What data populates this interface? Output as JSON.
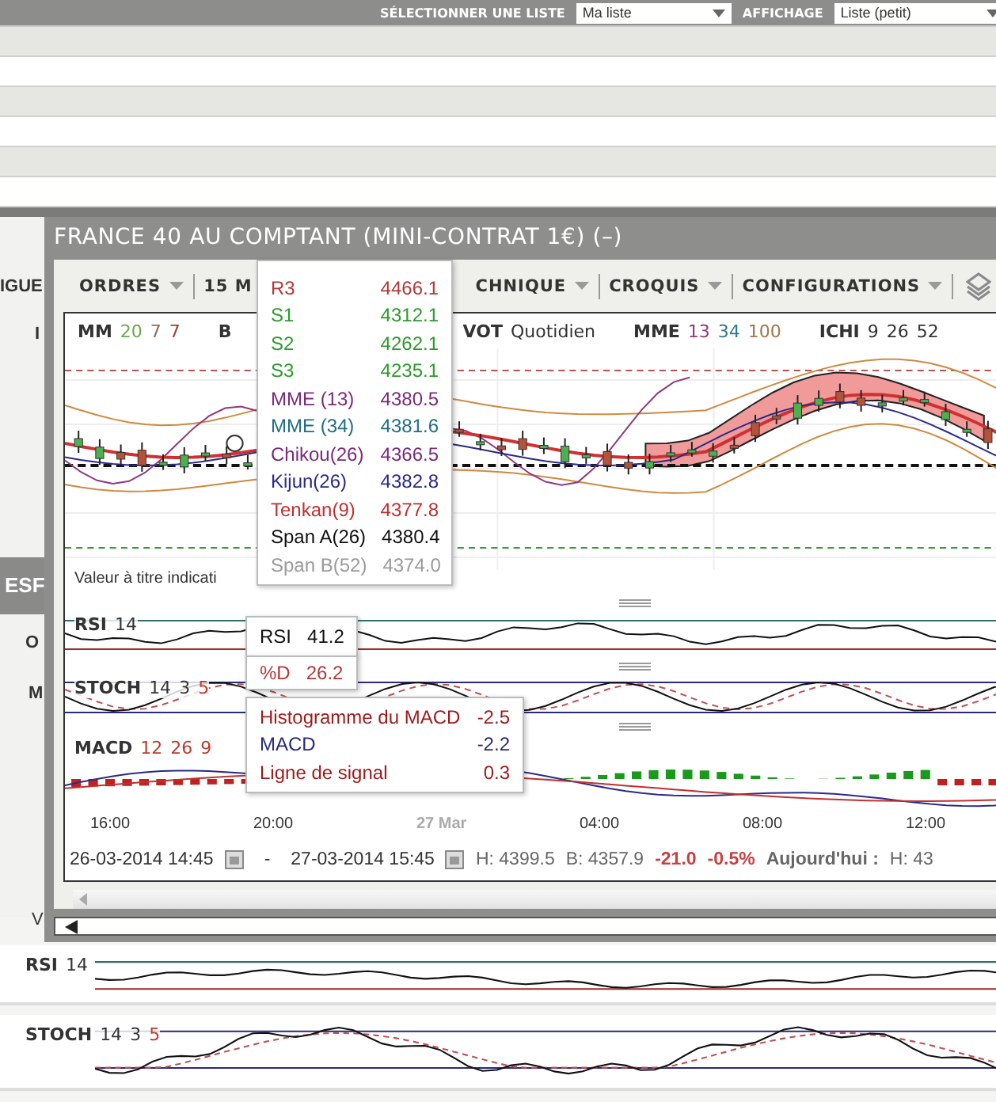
{
  "top_bar": {
    "list_label": "SÉLECTIONNER UNE LISTE",
    "list_value": "Ma liste",
    "display_label": "AFFICHAGE",
    "display_value": "Liste (petit)"
  },
  "background_window": {
    "fragments": [
      "IGUE",
      "I",
      "ESF",
      "O",
      "M",
      "V"
    ],
    "panels": [
      {
        "kind": "rsi",
        "label": "RSI",
        "params": [
          {
            "text": "14",
            "color": "#333333"
          }
        ]
      },
      {
        "kind": "stoch",
        "label": "STOCH",
        "params": [
          {
            "text": "14",
            "color": "#333333"
          },
          {
            "text": "3",
            "color": "#333333"
          },
          {
            "text": "5",
            "color": "#c0392b"
          }
        ]
      }
    ]
  },
  "window": {
    "title": "FRANCE 40 AU COMPTANT (MINI-CONTRAT 1€) (–)",
    "toolbar": [
      {
        "label": "ORDRES",
        "dropdown": true
      },
      {
        "label": "15 M",
        "dropdown": false
      },
      {
        "label": "CHNIQUE",
        "dropdown": true
      },
      {
        "label": "CROQUIS",
        "dropdown": true
      },
      {
        "label": "CONFIGURATIONS",
        "dropdown": true
      }
    ],
    "legends": [
      {
        "label": "MM",
        "params": [
          {
            "text": "20",
            "color": "#6aa84f"
          },
          {
            "text": "7",
            "color": "#8a7060"
          },
          {
            "text": "7",
            "color": "#a0412d"
          }
        ]
      },
      {
        "label": "B"
      },
      {
        "label": "VOT",
        "params": [
          {
            "text": "Quotidien",
            "color": "#333333"
          }
        ]
      },
      {
        "label": "MME",
        "params": [
          {
            "text": "13",
            "color": "#8e3a80"
          },
          {
            "text": "34",
            "color": "#2e7b8c"
          },
          {
            "text": "100",
            "color": "#a07850"
          }
        ]
      },
      {
        "label": "ICHI",
        "params": [
          {
            "text": "9",
            "color": "#333333"
          },
          {
            "text": "26",
            "color": "#333333"
          },
          {
            "text": "52",
            "color": "#333333"
          }
        ]
      }
    ],
    "note": "Valeur à titre indicati",
    "panels": [
      {
        "kind": "rsi",
        "label": "RSI",
        "params": [
          {
            "text": "14",
            "color": "#333333"
          }
        ]
      },
      {
        "kind": "stoch",
        "label": "STOCH",
        "params": [
          {
            "text": "14",
            "color": "#333333"
          },
          {
            "text": "3",
            "color": "#333333"
          },
          {
            "text": "5",
            "color": "#c0392b"
          }
        ]
      },
      {
        "kind": "macd",
        "label": "MACD",
        "params": [
          {
            "text": "12",
            "color": "#c0392b"
          },
          {
            "text": "26",
            "color": "#c0392b"
          },
          {
            "text": "9",
            "color": "#c0392b"
          }
        ]
      }
    ],
    "x_axis": [
      {
        "label": "16:00",
        "muted": false
      },
      {
        "label": "20:00",
        "muted": false
      },
      {
        "label": "27 Mar",
        "muted": true
      },
      {
        "label": "04:00",
        "muted": false
      },
      {
        "label": "08:00",
        "muted": false
      },
      {
        "label": "12:00",
        "muted": false
      }
    ],
    "footer": {
      "from": "26-03-2014 14:45",
      "separator": "-",
      "to": "27-03-2014 15:45",
      "high": "H: 4399.5",
      "low": "B: 4357.9",
      "change": "-21.0",
      "change_pct": "-0.5%",
      "today_label": "Aujourd'hui :",
      "today_high": "H: 43"
    }
  },
  "tooltips": [
    {
      "kind": "price",
      "rows": [
        {
          "label": "R3",
          "value": "4466.1",
          "color": "#b03a3a"
        },
        {
          "label": "S1",
          "value": "4312.1",
          "color": "#2e9a2e"
        },
        {
          "label": "S2",
          "value": "4262.1",
          "color": "#2e9a2e"
        },
        {
          "label": "S3",
          "value": "4235.1",
          "color": "#2e9a2e"
        },
        {
          "label": "MME (13)",
          "value": "4380.5",
          "color": "#7a2a7a"
        },
        {
          "label": "MME (34)",
          "value": "4381.6",
          "color": "#1f6f7f"
        },
        {
          "label": "Chikou(26)",
          "value": "4366.5",
          "color": "#7a2a7a"
        },
        {
          "label": "Kijun(26)",
          "value": "4382.8",
          "color": "#2a2a8a"
        },
        {
          "label": "Tenkan(9)",
          "value": "4377.8",
          "color": "#c03030"
        },
        {
          "label": "Span A(26)",
          "value": "4380.4",
          "color": "#111111"
        },
        {
          "label": "Span B(52)",
          "value": "4374.0",
          "color": "#9a9a9a"
        }
      ]
    },
    {
      "kind": "rsi",
      "rows": [
        {
          "label": "RSI",
          "value": "41.2",
          "color": "#111111"
        }
      ]
    },
    {
      "kind": "stoch",
      "rows": [
        {
          "label": "%D",
          "value": "26.2",
          "color": "#b03a3a"
        }
      ]
    },
    {
      "kind": "macd",
      "rows": [
        {
          "label": "Histogramme du MACD",
          "value": "-2.5",
          "color": "#9b1b1b"
        },
        {
          "label": "MACD",
          "value": "-2.2",
          "color": "#2a2a7a"
        },
        {
          "label": "Ligne de signal",
          "value": "0.3",
          "color": "#9b1b1b"
        }
      ]
    }
  ]
}
